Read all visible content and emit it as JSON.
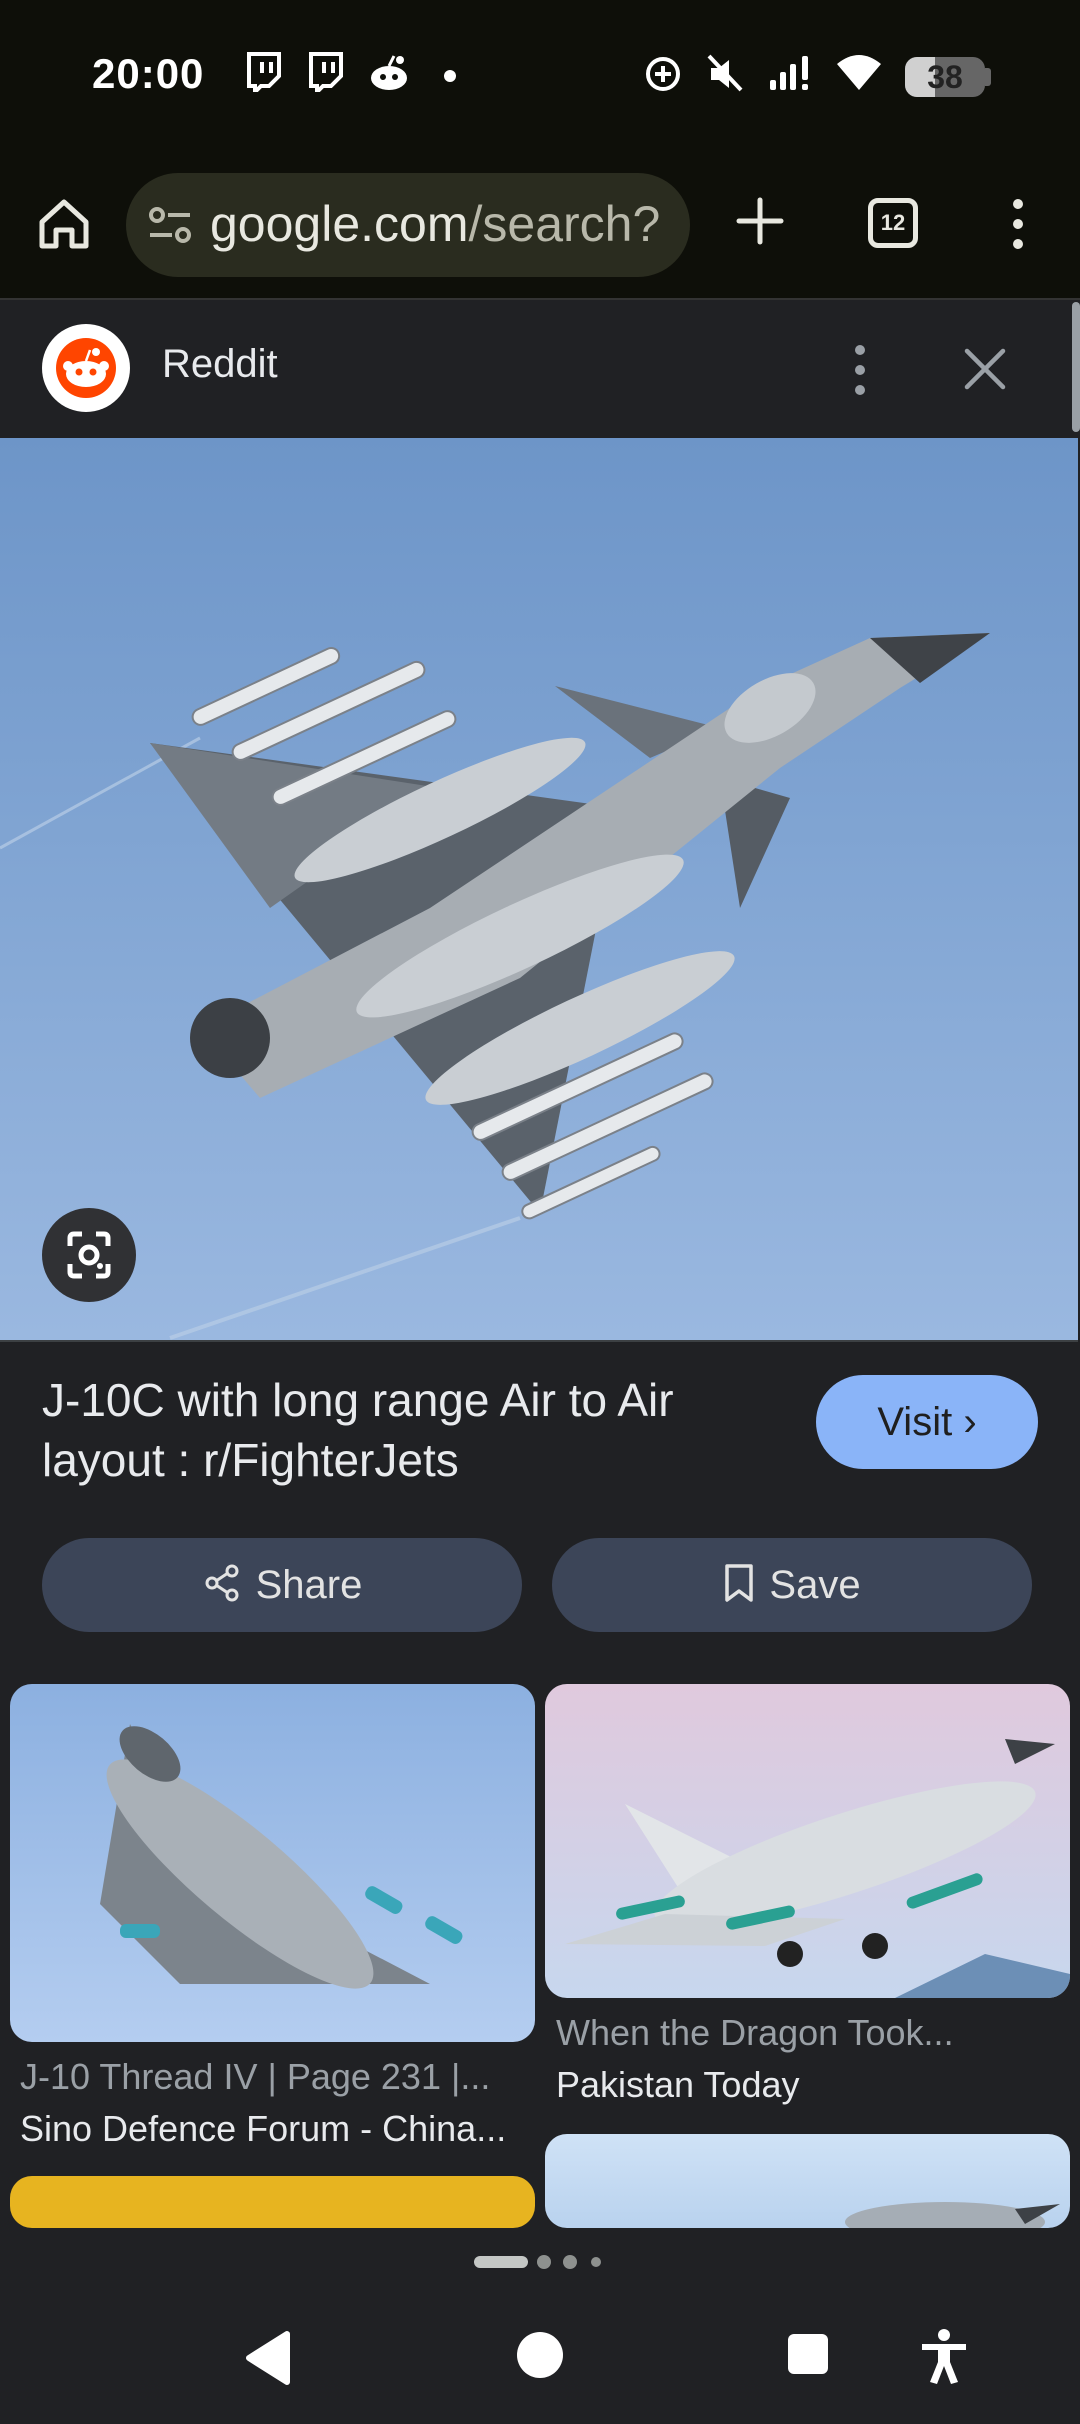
{
  "status_bar": {
    "time": "20:00",
    "battery_level": "38",
    "battery_fraction": 0.38,
    "left_icons": [
      "twitch-icon",
      "twitch-icon",
      "reddit-icon",
      "dot-icon"
    ],
    "right_icons": [
      "data-saver-icon",
      "mute-icon",
      "signal-icon",
      "wifi-icon",
      "battery-icon"
    ]
  },
  "toolbar": {
    "url_main": "google.com",
    "url_path": "/search?",
    "tab_count": "12"
  },
  "source": {
    "name": "Reddit"
  },
  "result": {
    "title": "J-10C with long range Air to Air layout : r/FighterJets",
    "visit_label": "Visit",
    "share_label": "Share",
    "save_label": "Save"
  },
  "related": [
    {
      "title": "J-10 Thread IV | Page 231 |...",
      "source": "Sino Defence Forum - China..."
    },
    {
      "title": "When the Dragon Took...",
      "source": "Pakistan Today"
    }
  ],
  "colors": {
    "accent": "#8ab4f8",
    "background": "#202124",
    "chrome_bar": "#0e0f09"
  }
}
